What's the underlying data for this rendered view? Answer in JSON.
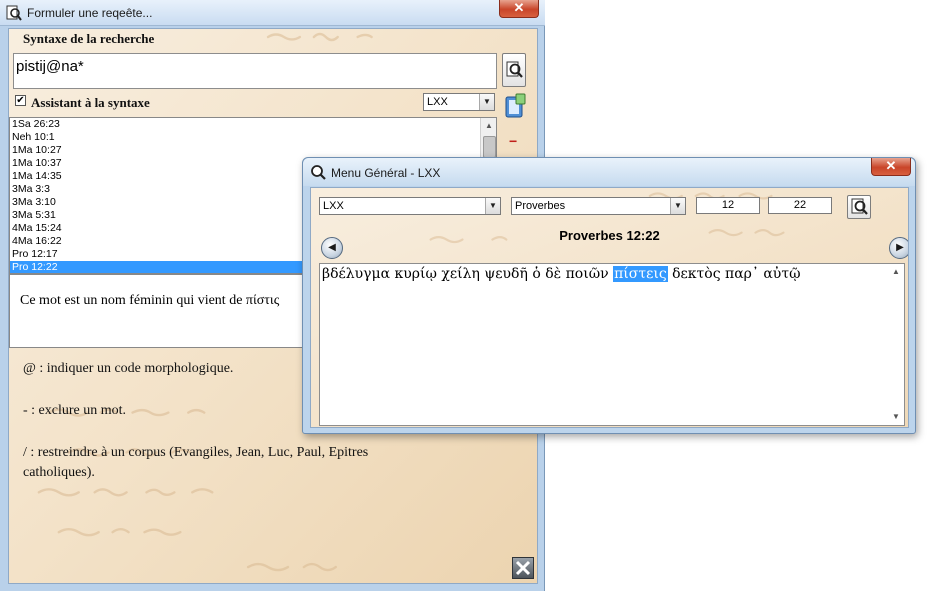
{
  "query_window": {
    "title": "Formuler une reqeête...",
    "close_glyph": "✕",
    "syntax_label": "Syntaxe de la recherche",
    "search_value": "pistij@na*",
    "assistant_checked": "✔",
    "assistant_label": "Assistant à la syntaxe",
    "corpus_select": "LXX",
    "minus_glyph": "−",
    "results": [
      "1Sa 26:23",
      "Neh 10:1",
      "1Ma 10:27",
      "1Ma 10:37",
      "1Ma 14:35",
      "3Ma 3:3",
      "3Ma 3:10",
      "3Ma 5:31",
      "4Ma 15:24",
      "4Ma 16:22",
      "Pro 12:17",
      "Pro 12:22"
    ],
    "selected_result": "Pro 12:22",
    "description": "Ce mot est un nom féminin qui vient de πίστις",
    "help": [
      "@ : indiquer un code morphologique.",
      "- : exclure un mot.",
      "/ : restreindre à un corpus (Evangiles, Jean, Luc, Paul, Epitres catholiques)."
    ]
  },
  "menu_window": {
    "title": "Menu Général - LXX",
    "close_glyph": "✕",
    "corpus_select": "LXX",
    "book_select": "Proverbes",
    "chapter": "12",
    "verse": "22",
    "prev_glyph": "◀",
    "next_glyph": "▶",
    "reference": "Proverbes 12:22",
    "text_before": "βδέλυγμα κυρίῳ χείλη ψευδῆ ὁ δὲ ποιῶν ",
    "text_highlight": "πίστεις",
    "text_after": " δεκτὸς παρ᾽ αὐτῷ"
  }
}
